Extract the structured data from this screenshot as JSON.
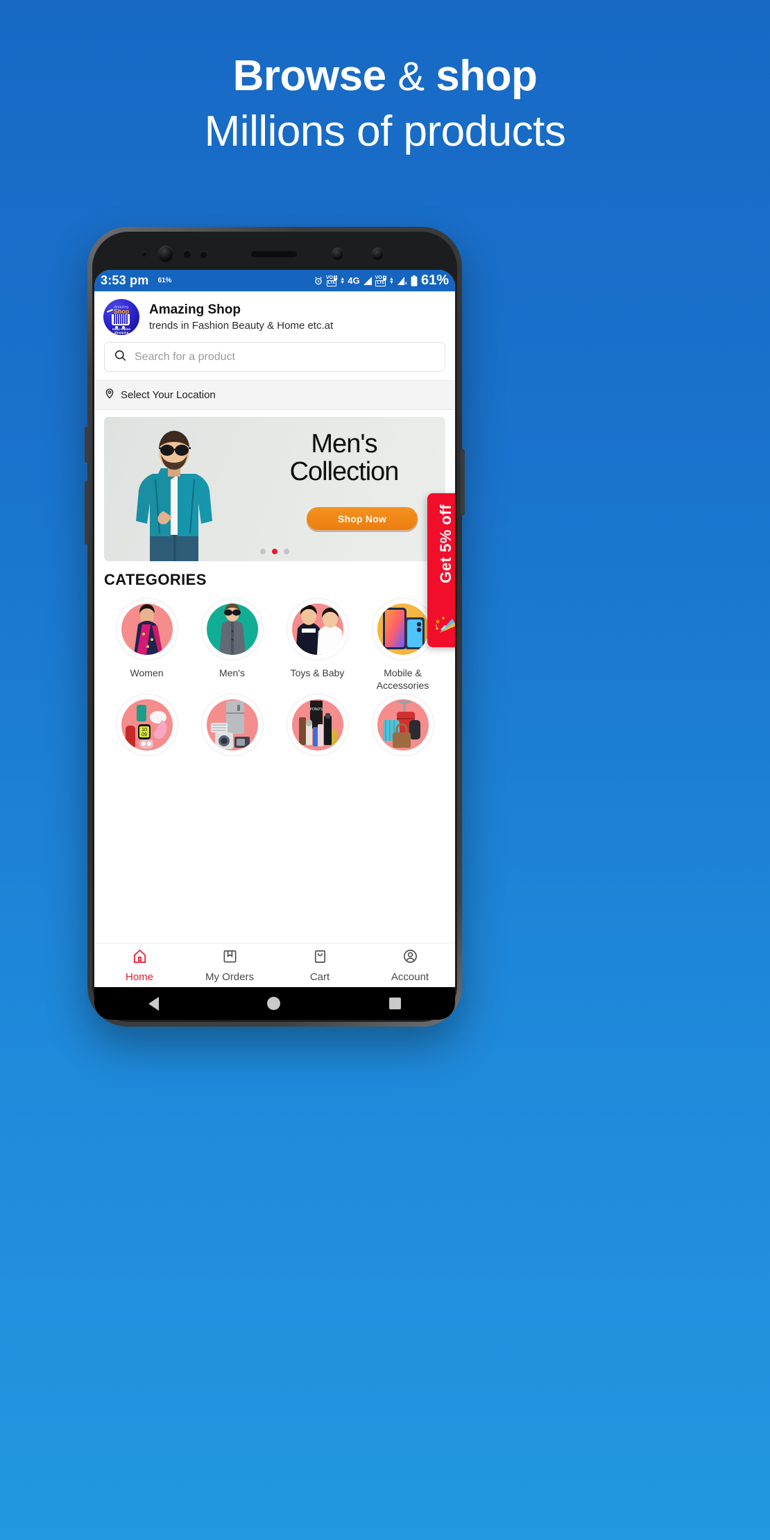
{
  "promo": {
    "headline_line1_a": "Browse",
    "headline_line1_amp": "&",
    "headline_line1_b": "shop",
    "headline_line2": "Millions of products",
    "background_color": "#1a73cc"
  },
  "status_bar": {
    "time": "3:53 pm",
    "battery_small": "61%",
    "network_label": "4G",
    "volte_1": "VoLTE",
    "sim_1": "1",
    "volte_2": "VoLTE",
    "sim_2": "2",
    "lte_label": "LTE",
    "vo_label": "VO",
    "battery_percent": "61%",
    "bar_color": "#1565c0"
  },
  "app_header": {
    "name": "Amazing Shop",
    "tagline": "trends in Fashion Beauty & Home etc.at",
    "logo": {
      "brand_small": "Amazing",
      "brand_word": "Shop",
      "sub_line1": "India Online",
      "sub_line2": "Shopping"
    }
  },
  "search": {
    "placeholder": "Search for a product",
    "value": ""
  },
  "location": {
    "label": "Select Your Location"
  },
  "banner": {
    "title_line1": "Men's",
    "title_line2": "Collection",
    "cta": "Shop Now",
    "cta_color": "#ed7d10",
    "dots": 3,
    "active_dot": 2,
    "active_dot_color": "#e8192c"
  },
  "offer_tab": {
    "label": "Get 5% off",
    "color": "#f20d2b"
  },
  "categories": {
    "title": "CATEGORIES",
    "items": [
      {
        "label": "Women",
        "icon": "woman-saree-icon",
        "bubble": "#f58d8d"
      },
      {
        "label": "Men's",
        "icon": "man-shirt-icon",
        "bubble": "#12ad95"
      },
      {
        "label": "Toys & Baby",
        "icon": "kids-icon",
        "bubble": "#f58d8d"
      },
      {
        "label": "Mobile & Accessories",
        "icon": "smartphone-icon",
        "bubble": "#f3b44a"
      },
      {
        "label": "",
        "icon": "gadgets-icon",
        "bubble": "#f58d8d"
      },
      {
        "label": "",
        "icon": "appliances-icon",
        "bubble": "#f58d8d"
      },
      {
        "label": "",
        "icon": "beauty-icon",
        "bubble": "#f58d8d"
      },
      {
        "label": "",
        "icon": "bags-luggage-icon",
        "bubble": "#f58d8d"
      }
    ]
  },
  "bottom_nav": {
    "active": "Home",
    "active_color": "#e8192c",
    "items": [
      {
        "label": "Home",
        "icon": "home-icon"
      },
      {
        "label": "My Orders",
        "icon": "orders-box-icon"
      },
      {
        "label": "Cart",
        "icon": "cart-bag-icon"
      },
      {
        "label": "Account",
        "icon": "account-person-icon"
      }
    ]
  }
}
